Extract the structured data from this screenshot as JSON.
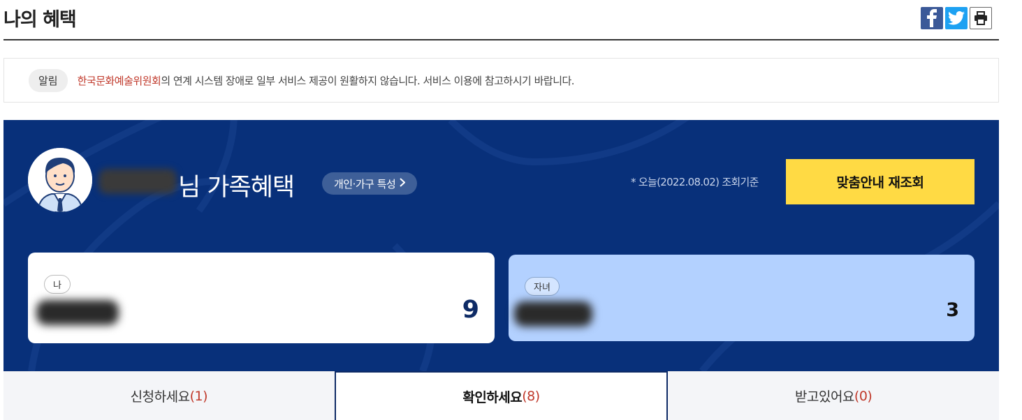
{
  "page": {
    "title": "나의 혜택"
  },
  "share": {
    "facebook_icon": "facebook-icon",
    "twitter_icon": "twitter-icon",
    "print_icon": "print-icon"
  },
  "notice": {
    "badge": "알림",
    "organization": "한국문화예술위원회",
    "message": "의 연계 시스템 장애로 일부 서비스 제공이 원활하지 않습니다. 서비스 이용에 참고하시기 바랍니다."
  },
  "benefit": {
    "headline": "님 가족혜택",
    "profile_button": "개인·가구 특성",
    "query_date": "* 오늘(2022.08.02) 조회기준",
    "refresh_button": "맞춤안내 재조회"
  },
  "members": [
    {
      "tag": "나",
      "count": "9"
    },
    {
      "tag": "자녀",
      "count": "3"
    }
  ],
  "tabs": [
    {
      "label": "신청하세요",
      "count": "(1)"
    },
    {
      "label": "확인하세요",
      "count": "(8)"
    },
    {
      "label": "받고있어요",
      "count": "(0)"
    }
  ],
  "colors": {
    "panel_bg": "#08307a",
    "refresh_button": "#ffda44",
    "child_card": "#b3d1ff",
    "accent_red": "#c0392b"
  }
}
